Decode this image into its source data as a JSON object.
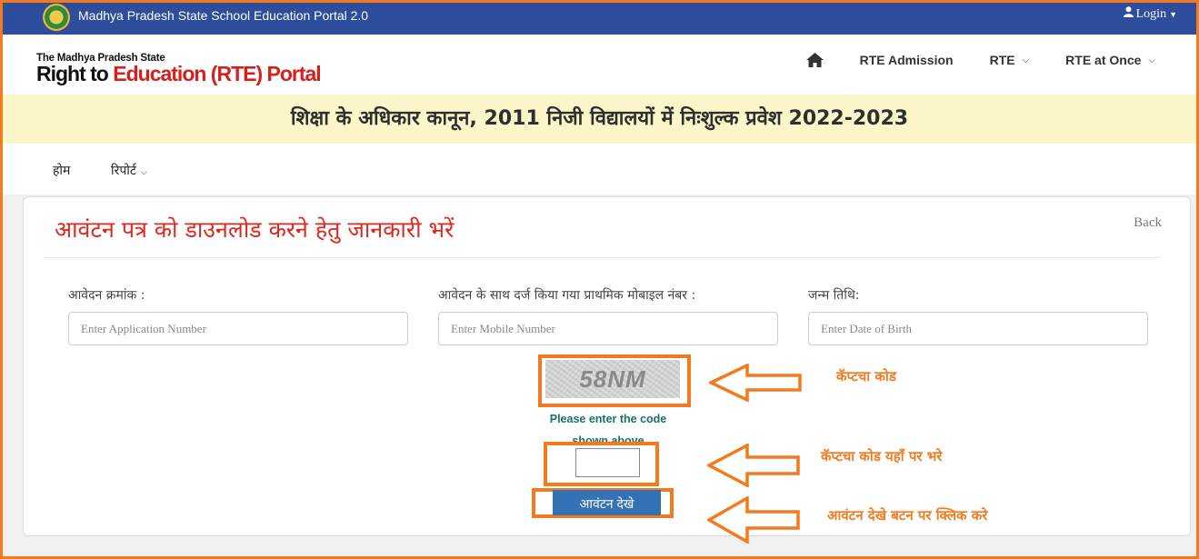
{
  "topbar": {
    "title": "Madhya Pradesh State School Education Portal 2.0",
    "login": "Login"
  },
  "brand": {
    "line1": "The Madhya Pradesh State",
    "line2a": "Right to ",
    "line2b": "Education",
    "line2c": " (RTE) Portal"
  },
  "nav": {
    "home_icon": "home-icon",
    "items": [
      "RTE Admission",
      "RTE",
      "RTE at Once"
    ]
  },
  "banner": "शिक्षा के अधिकार कानून, 2011 निजी विद्यालयों में निःशुल्क प्रवेश 2022-2023",
  "subnav": {
    "home": "होम",
    "report": "रिपोर्ट"
  },
  "form": {
    "title": "आवंटन पत्र को डाउनलोड करने हेतु जानकारी भरें",
    "back": "Back",
    "fields": [
      {
        "label": "आवेदन क्रमांक :",
        "placeholder": "Enter Application Number"
      },
      {
        "label": "आवेदन के साथ दर्ज किया गया प्राथमिक मोबाइल नंबर :",
        "placeholder": "Enter Mobile Number"
      },
      {
        "label": "जन्म तिथि:",
        "placeholder": "Enter Date of Birth"
      }
    ],
    "captcha_text": "58NM",
    "captcha_help": "Please enter the code shown above",
    "submit": "आवंटन देखे"
  },
  "annotations": {
    "captcha": "कॅप्टचा कोड",
    "enter_code": "कॅप्टचा कोड यहाँ पर भरे",
    "click_button": "आवंटन देखे बटन पर क्लिक करे",
    "accent_color": "#f47a20"
  }
}
